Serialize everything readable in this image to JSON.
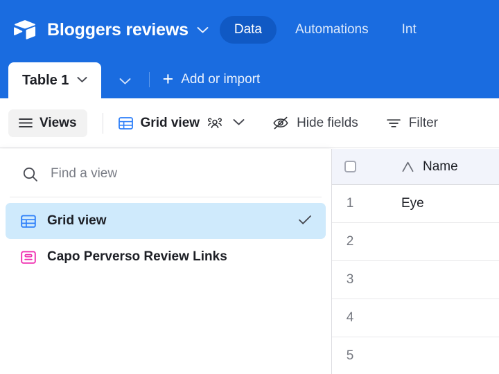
{
  "header": {
    "logo_icon": "airtable-cube-logo",
    "base_title": "Bloggers reviews",
    "base_chevron_icon": "chevron-down-icon",
    "tabs": [
      {
        "label": "Data",
        "active": true
      },
      {
        "label": "Automations",
        "active": false
      },
      {
        "label": "Int",
        "active": false
      }
    ],
    "bar_color": "#1a6ce0",
    "active_tab_color": "#1059c4"
  },
  "tabstrip": {
    "table_tab_label": "Table 1",
    "table_tab_chevron_icon": "chevron-down-icon",
    "strip_chevron_icon": "chevron-down-icon",
    "add_plus_icon": "plus-icon",
    "add_import_label": "Add or import"
  },
  "toolbar": {
    "views_icon": "hamburger-menu-icon",
    "views_label": "Views",
    "grid_view_icon": "grid-view-icon",
    "grid_view_label": "Grid view",
    "collaborators_icon": "people-collaborators-icon",
    "view_chevron_icon": "chevron-down-icon",
    "hide_fields_icon": "eye-slash-icon",
    "hide_fields_label": "Hide fields",
    "filter_icon": "filter-funnel-icon",
    "filter_label": "Filter"
  },
  "views_panel": {
    "search_icon": "search-icon",
    "search_value": "",
    "search_placeholder": "Find a view",
    "items": [
      {
        "label": "Grid view",
        "icon": "grid-view-icon",
        "icon_color": "#2d7ff9",
        "selected": true,
        "check_icon": "checkmark-icon"
      },
      {
        "label": "Capo Perverso Review Links",
        "icon": "form-view-icon",
        "icon_color": "#ef2eb0",
        "selected": false,
        "check_icon": ""
      }
    ]
  },
  "grid": {
    "select_all_icon": "checkbox-unchecked-icon",
    "columns": [
      {
        "name": "Name",
        "type_icon": "text-field-icon"
      }
    ],
    "rows": [
      {
        "num": "1",
        "name": "Eye"
      },
      {
        "num": "2",
        "name": ""
      },
      {
        "num": "3",
        "name": ""
      },
      {
        "num": "4",
        "name": ""
      },
      {
        "num": "5",
        "name": ""
      }
    ]
  }
}
